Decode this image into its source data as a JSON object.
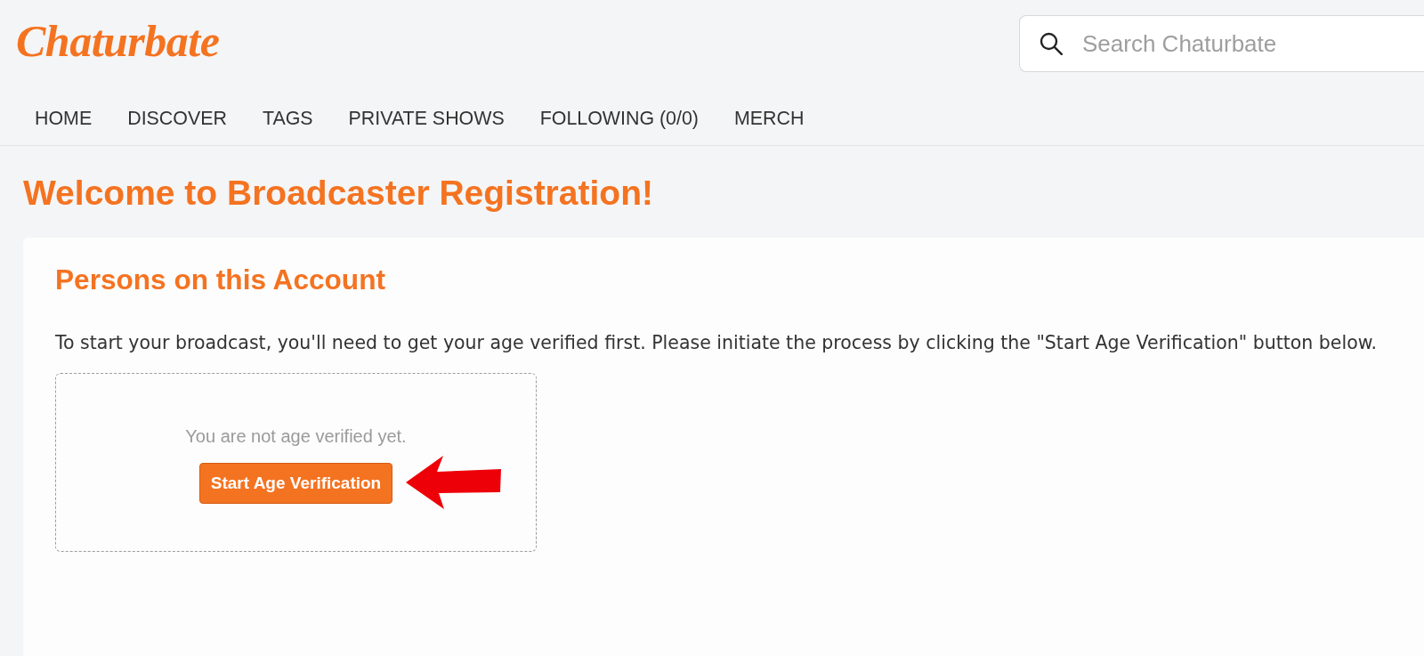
{
  "header": {
    "logo": "Chaturbate",
    "search": {
      "placeholder": "Search Chaturbate"
    }
  },
  "nav": [
    "HOME",
    "DISCOVER",
    "TAGS",
    "PRIVATE SHOWS",
    "FOLLOWING (0/0)",
    "MERCH"
  ],
  "page_title": "Welcome to Broadcaster Registration!",
  "card": {
    "title": "Persons on this Account",
    "message": "To start your broadcast, you'll need to get your age verified first. Please initiate the process by clicking the \"Start Age Verification\" button below.",
    "verification": {
      "status": "You are not age verified yet.",
      "button": "Start Age Verification"
    }
  }
}
